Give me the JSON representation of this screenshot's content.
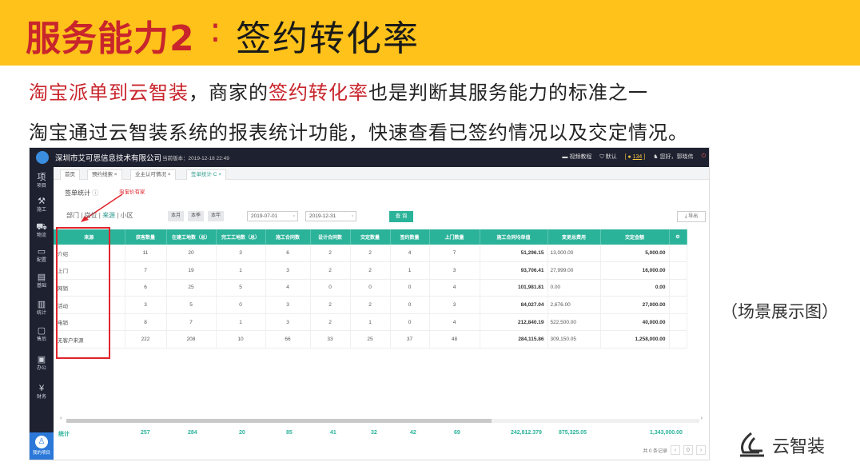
{
  "slide": {
    "title_red": "服务能力2",
    "title_colon": ":",
    "title_black": "签约转化率",
    "line1_red_a": "淘宝派单到云智装",
    "line1_plain_a": "，商家的",
    "line1_red_b": "签约转化率",
    "line1_plain_b": "也是判断其服务能力的标准之一",
    "line2": "淘宝通过云智装系统的报表统计功能，快速查看已签约情况以及交定情况。",
    "scene_label": "（场景展示图）",
    "brand_name": "云智装"
  },
  "app": {
    "company": "深圳市艾可思信息技术有限公司",
    "version": "当前版本：2019-12-18 22:49",
    "top_right": {
      "tutorial": "视频教程",
      "default": "默认",
      "coins": "134",
      "greeting": "您好，郭晓伟"
    },
    "nav": [
      {
        "icon": "项",
        "label": "项目"
      },
      {
        "icon": "⚒",
        "label": "施工"
      },
      {
        "icon": "⛟",
        "label": "物流"
      },
      {
        "icon": "▭",
        "label": "配置"
      },
      {
        "icon": "▤",
        "label": "基础"
      },
      {
        "icon": "▥",
        "label": "统计"
      },
      {
        "icon": "▢",
        "label": "售后"
      },
      {
        "icon": "▣",
        "label": "办公"
      },
      {
        "icon": "¥",
        "label": "财务"
      }
    ],
    "nav_user": "我的项目",
    "tabs": [
      "首页",
      "预约线索 ×",
      "业主认可情况 ×",
      "签单统计 C ×"
    ],
    "subhead": "签单统计",
    "annotation": "淘宝价有家",
    "filter_tabs": [
      "部门",
      "岗位",
      "来源",
      "小区"
    ],
    "period_buttons": [
      "本月",
      "本季",
      "本年"
    ],
    "date_from": "2019-07-01",
    "date_to": "2019-12-31",
    "query": "查 询",
    "export": "导出",
    "table": {
      "headers": [
        "来源",
        "获客数量",
        "在建工地数（总）",
        "完工工地数（总）",
        "施工合同数",
        "设计合同数",
        "交定数量",
        "签约数量",
        "上门数量",
        "施工合同均单值",
        "变更总费用",
        "交定金额"
      ],
      "rows": [
        [
          "介绍",
          "11",
          "20",
          "3",
          "6",
          "2",
          "2",
          "4",
          "7",
          "51,296.15",
          "13,000.00",
          "5,000.00"
        ],
        [
          "上门",
          "7",
          "19",
          "1",
          "3",
          "2",
          "2",
          "1",
          "3",
          "93,706.41",
          "27,999.00",
          "16,000.00"
        ],
        [
          "网销",
          "6",
          "25",
          "5",
          "4",
          "0",
          "0",
          "0",
          "4",
          "101,981.81",
          "0.00",
          "0.00"
        ],
        [
          "活动",
          "3",
          "5",
          "0",
          "3",
          "2",
          "2",
          "0",
          "3",
          "84,027.04",
          "2,676.00",
          "27,000.00"
        ],
        [
          "电销",
          "8",
          "7",
          "1",
          "3",
          "2",
          "1",
          "0",
          "4",
          "212,840.19",
          "522,500.00",
          "40,000.00"
        ],
        [
          "无客户来源",
          "222",
          "208",
          "10",
          "66",
          "33",
          "25",
          "37",
          "48",
          "284,115.86",
          "309,150.05",
          "1,258,000.00"
        ]
      ]
    },
    "totals": {
      "label": "统计",
      "values": [
        "257",
        "284",
        "20",
        "85",
        "41",
        "32",
        "42",
        "69",
        "242,812.379",
        "875,325.05",
        "1,343,000.00"
      ]
    },
    "pager_text": "共 0 条记录",
    "pager_page": "0"
  }
}
